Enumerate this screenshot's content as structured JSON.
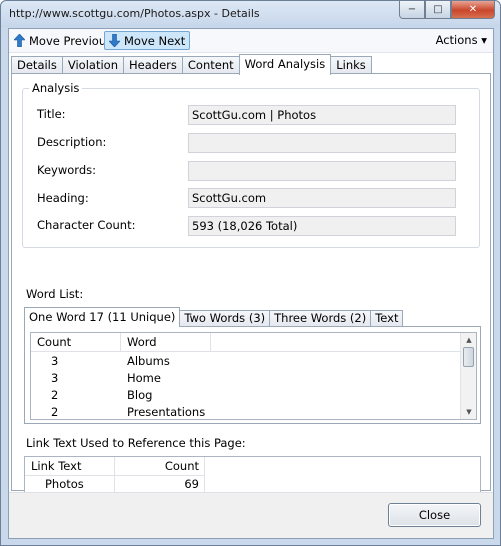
{
  "window": {
    "title": "http://www.scottgu.com/Photos.aspx - Details",
    "minimize": "−",
    "maximize": "□",
    "close": "✕"
  },
  "toolbar": {
    "move_previous": "Move Previous",
    "move_next": "Move Next",
    "actions": "Actions ▾"
  },
  "tabs": [
    "Details",
    "Violation",
    "Headers",
    "Content",
    "Word Analysis",
    "Links"
  ],
  "analysis": {
    "legend": "Analysis",
    "title_label": "Title:",
    "title_value": "ScottGu.com | Photos",
    "description_label": "Description:",
    "description_value": "",
    "keywords_label": "Keywords:",
    "keywords_value": "",
    "heading_label": "Heading:",
    "heading_value": "ScottGu.com",
    "charcount_label": "Character Count:",
    "charcount_value": "593 (18,026 Total)"
  },
  "word_list": {
    "label": "Word List:",
    "tabs": [
      "One Word 17 (11 Unique)",
      "Two Words (3)",
      "Three Words (2)",
      "Text"
    ],
    "columns": [
      "Count",
      "Word"
    ],
    "rows": [
      {
        "count": "3",
        "word": "Albums"
      },
      {
        "count": "3",
        "word": "Home"
      },
      {
        "count": "2",
        "word": "Blog"
      },
      {
        "count": "2",
        "word": "Presentations"
      }
    ]
  },
  "link_text": {
    "label": "Link Text Used to Reference this Page:",
    "columns": [
      "Link Text",
      "Count"
    ],
    "rows": [
      {
        "text": "Photos",
        "count": "69"
      }
    ]
  },
  "close_button": "Close"
}
